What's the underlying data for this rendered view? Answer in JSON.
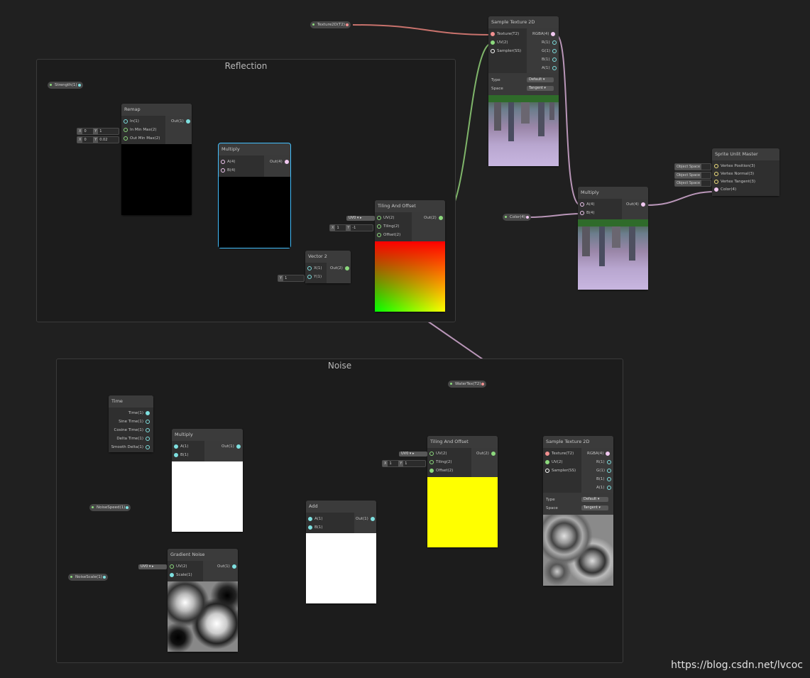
{
  "groups": {
    "reflection": "Reflection",
    "noise": "Noise"
  },
  "properties": {
    "strength": "Strength(1)",
    "texture2d": "Texture2D(T2)",
    "color": "Color(4)",
    "watertex": "WaterTex(T2)",
    "noisespeed": "NoiseSpeed(1)",
    "noisescale": "NoiseScale(1)"
  },
  "remap": {
    "title": "Remap",
    "inputs": [
      "In(1)",
      "In Min Max(2)",
      "Out Min Max(2)"
    ],
    "output": "Out(1)",
    "inmm": {
      "x_tag": "X",
      "x": "0",
      "y_tag": "Y",
      "y": "1"
    },
    "outmm": {
      "x_tag": "X",
      "x": "0",
      "y_tag": "Y",
      "y": "0.02"
    }
  },
  "multiply_reflect": {
    "title": "Multiply",
    "inputs": [
      "A(4)",
      "B(4)"
    ],
    "output": "Out(4)"
  },
  "vector2": {
    "title": "Vector 2",
    "inputs": [
      "X(1)",
      "Y(1)"
    ],
    "output": "Out(2)",
    "y_tag": "Y",
    "y": "1"
  },
  "tiling_reflect": {
    "title": "Tiling And Offset",
    "inputs": [
      "UV(2)",
      "Tiling(2)",
      "Offset(2)"
    ],
    "output": "Out(2)",
    "uv": "UV0",
    "tiling": {
      "x_tag": "X",
      "x": "1",
      "y_tag": "Y",
      "y": "-1"
    }
  },
  "sample_top": {
    "title": "Sample Texture 2D",
    "inputs": [
      "Texture(T2)",
      "UV(2)",
      "Sampler(SS)"
    ],
    "outputs": [
      "RGBA(4)",
      "R(1)",
      "G(1)",
      "B(1)",
      "A(1)"
    ],
    "type_label": "Type",
    "type_value": "Default",
    "space_label": "Space",
    "space_value": "Tangent"
  },
  "multiply_final": {
    "title": "Multiply",
    "inputs": [
      "A(4)",
      "B(4)"
    ],
    "output": "Out(4)"
  },
  "sprite_master": {
    "title": "Sprite Unlit Master",
    "inputs": [
      "Vertex Position(3)",
      "Vertex Normal(3)",
      "Vertex Tangent(3)",
      "Color(4)"
    ],
    "spaces": [
      "Object Space",
      "Object Space",
      "Object Space"
    ]
  },
  "time": {
    "title": "Time",
    "outputs": [
      "Time(1)",
      "Sine Time(1)",
      "Cosine Time(1)",
      "Delta Time(1)",
      "Smooth Delta(1)"
    ]
  },
  "multiply_noise": {
    "title": "Multiply",
    "inputs": [
      "A(1)",
      "B(1)"
    ],
    "output": "Out(1)"
  },
  "gradient_noise": {
    "title": "Gradient Noise",
    "inputs": [
      "UV(2)",
      "Scale(1)"
    ],
    "output": "Out(1)",
    "uv": "UV0"
  },
  "add": {
    "title": "Add",
    "inputs": [
      "A(1)",
      "B(1)"
    ],
    "output": "Out(1)"
  },
  "tiling_noise": {
    "title": "Tiling And Offset",
    "inputs": [
      "UV(2)",
      "Tiling(2)",
      "Offset(2)"
    ],
    "output": "Out(2)",
    "uv": "UV0",
    "tiling": {
      "x_tag": "X",
      "x": "1",
      "y_tag": "Y",
      "y": "1"
    }
  },
  "sample_bottom": {
    "title": "Sample Texture 2D",
    "inputs": [
      "Texture(T2)",
      "UV(2)",
      "Sampler(SS)"
    ],
    "outputs": [
      "RGBA(4)",
      "R(1)",
      "G(1)",
      "B(1)",
      "A(1)"
    ],
    "type_label": "Type",
    "type_value": "Default",
    "space_label": "Space",
    "space_value": "Tangent"
  },
  "watermark": "https://blog.csdn.net/lvcoc",
  "colors": {
    "background": "#202020",
    "node_header": "#3b3b3b",
    "wire_float": "#5fa8a0",
    "wire_vec2": "#7fb56a",
    "wire_vec4": "#b996b8",
    "wire_texture": "#c8726c",
    "selected": "#44c0ff"
  }
}
